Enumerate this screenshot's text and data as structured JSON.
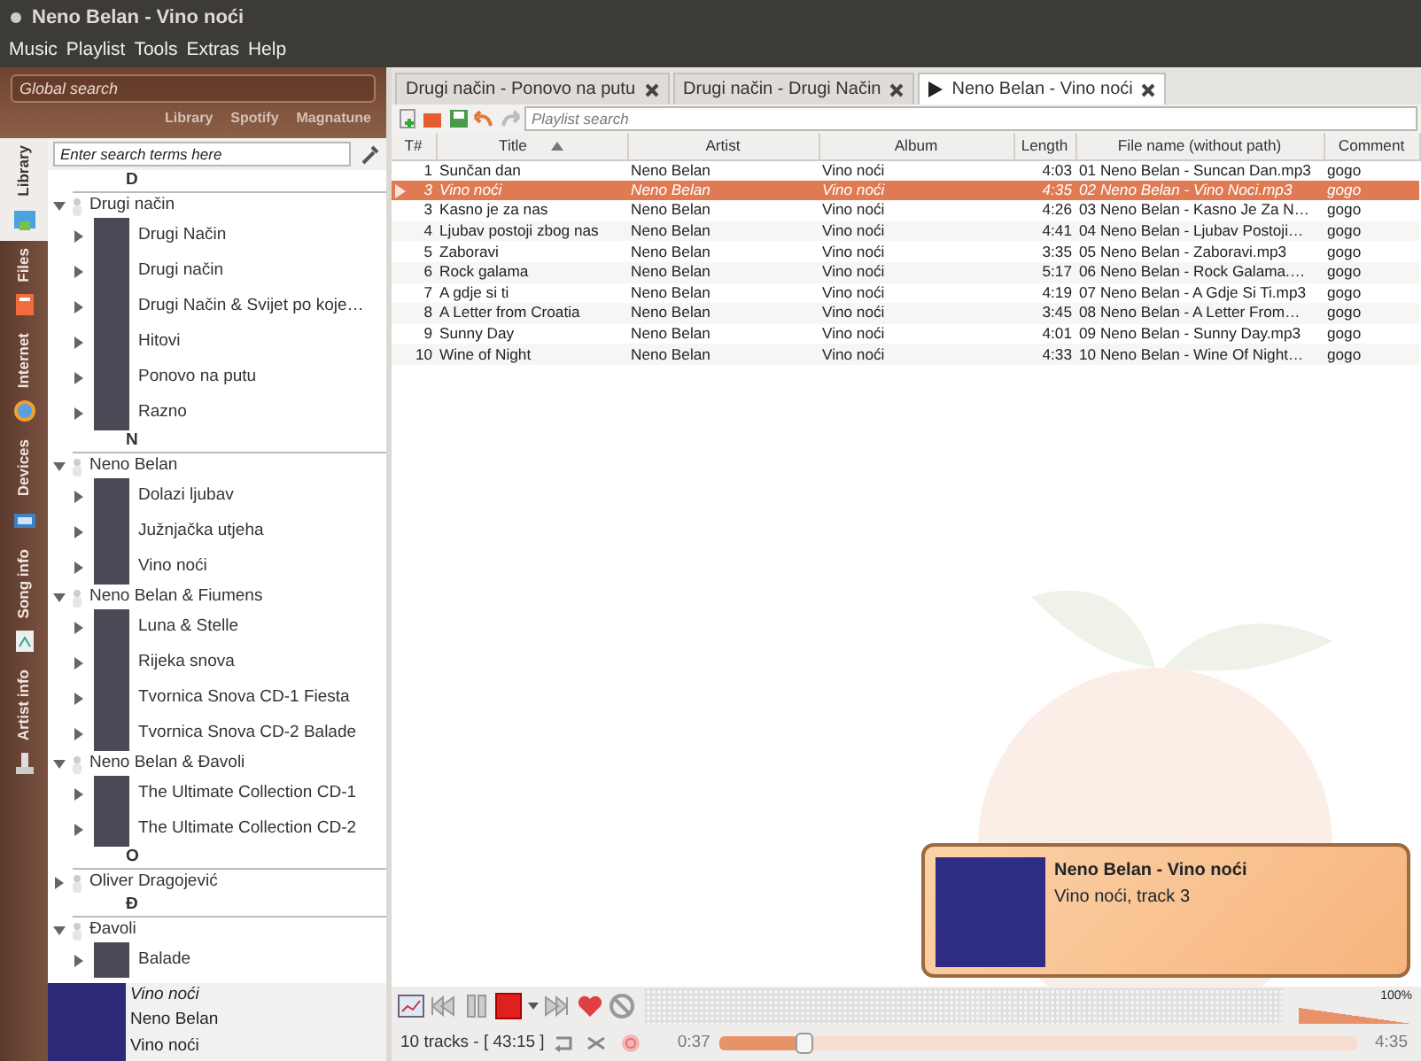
{
  "window": {
    "title": "Neno Belan - Vino noći"
  },
  "menu": [
    "Music",
    "Playlist",
    "Tools",
    "Extras",
    "Help"
  ],
  "global_search": {
    "placeholder": "Global search",
    "sources": [
      "Library",
      "Spotify",
      "Magnatune"
    ]
  },
  "side_tabs": [
    {
      "label": "Library",
      "selected": true
    },
    {
      "label": "Files",
      "selected": false
    },
    {
      "label": "Internet",
      "selected": false
    },
    {
      "label": "Devices",
      "selected": false
    },
    {
      "label": "Song info",
      "selected": false
    },
    {
      "label": "Artist info",
      "selected": false
    }
  ],
  "library": {
    "search_placeholder": "Enter search terms here",
    "tree": [
      {
        "kind": "divider",
        "label": "D"
      },
      {
        "kind": "artist",
        "label": "Drugi način",
        "expanded": true,
        "children": [
          {
            "label": "Drugi Način",
            "expanded": false
          },
          {
            "label": "Drugi način",
            "expanded": false
          },
          {
            "label": "Drugi Način & Svijet po koje…",
            "expanded": false
          },
          {
            "label": "Hitovi",
            "expanded": false
          },
          {
            "label": "Ponovo na putu",
            "expanded": false
          },
          {
            "label": "Razno",
            "expanded": false
          }
        ]
      },
      {
        "kind": "divider",
        "label": "N"
      },
      {
        "kind": "artist",
        "label": "Neno Belan",
        "expanded": true,
        "children": [
          {
            "label": "Dolazi ljubav",
            "expanded": false
          },
          {
            "label": "Južnjačka utjeha",
            "expanded": false
          },
          {
            "label": "Vino noći",
            "expanded": false
          }
        ]
      },
      {
        "kind": "artist",
        "label": "Neno Belan & Fiumens",
        "expanded": true,
        "children": [
          {
            "label": "Luna & Stelle",
            "expanded": false
          },
          {
            "label": "Rijeka snova",
            "expanded": false
          },
          {
            "label": "Tvornica Snova CD-1 Fiesta",
            "expanded": false
          },
          {
            "label": "Tvornica Snova CD-2 Balade",
            "expanded": false
          }
        ]
      },
      {
        "kind": "artist",
        "label": "Neno Belan & Đavoli",
        "expanded": true,
        "children": [
          {
            "label": "The Ultimate Collection CD-1",
            "expanded": false
          },
          {
            "label": "The Ultimate Collection CD-2",
            "expanded": false
          }
        ]
      },
      {
        "kind": "divider",
        "label": "O"
      },
      {
        "kind": "artist",
        "label": "Oliver Dragojević",
        "expanded": false
      },
      {
        "kind": "divider",
        "label": "Đ"
      },
      {
        "kind": "artist",
        "label": "Đavoli",
        "expanded": true,
        "children": [
          {
            "label": "Balade",
            "expanded": false
          }
        ]
      }
    ]
  },
  "now_playing": {
    "title": "Vino noći",
    "artist": "Neno Belan",
    "album": "Vino noći"
  },
  "playlist_tabs": [
    {
      "label": "Drugi način - Ponovo na putu",
      "selected": false,
      "playing": false
    },
    {
      "label": "Drugi način - Drugi Način",
      "selected": false,
      "playing": false
    },
    {
      "label": "Neno Belan - Vino noći",
      "selected": true,
      "playing": true
    }
  ],
  "playlist": {
    "search_placeholder": "Playlist search",
    "columns": [
      {
        "label": "T#",
        "sorted": false
      },
      {
        "label": "Title",
        "sorted": true
      },
      {
        "label": "Artist",
        "sorted": false
      },
      {
        "label": "Album",
        "sorted": false
      },
      {
        "label": "Length",
        "sorted": false
      },
      {
        "label": "File name (without path)",
        "sorted": false
      },
      {
        "label": "Comment",
        "sorted": false
      }
    ],
    "rows": [
      {
        "playing": false,
        "cells": [
          "1",
          "Sunčan dan",
          "Neno Belan",
          "Vino noći",
          "4:03",
          "01 Neno Belan - Suncan Dan.mp3",
          "gogo"
        ]
      },
      {
        "playing": true,
        "cells": [
          "3",
          "Vino noći",
          "Neno Belan",
          "Vino noći",
          "4:35",
          "02 Neno Belan - Vino Noci.mp3",
          "gogo"
        ]
      },
      {
        "playing": false,
        "cells": [
          "3",
          "Kasno je za nas",
          "Neno Belan",
          "Vino noći",
          "4:26",
          "03 Neno Belan - Kasno Je Za N…",
          "gogo"
        ]
      },
      {
        "playing": false,
        "cells": [
          "4",
          "Ljubav postoji zbog nas",
          "Neno Belan",
          "Vino noći",
          "4:41",
          "04 Neno Belan - Ljubav Postoji…",
          "gogo"
        ]
      },
      {
        "playing": false,
        "cells": [
          "5",
          "Zaboravi",
          "Neno Belan",
          "Vino noći",
          "3:35",
          "05 Neno Belan - Zaboravi.mp3",
          "gogo"
        ]
      },
      {
        "playing": false,
        "cells": [
          "6",
          "Rock galama",
          "Neno Belan",
          "Vino noći",
          "5:17",
          "06 Neno Belan - Rock Galama.…",
          "gogo"
        ]
      },
      {
        "playing": false,
        "cells": [
          "7",
          "A gdje si ti",
          "Neno Belan",
          "Vino noći",
          "4:19",
          "07 Neno Belan - A Gdje Si Ti.mp3",
          "gogo"
        ]
      },
      {
        "playing": false,
        "cells": [
          "8",
          "A Letter from Croatia",
          "Neno Belan",
          "Vino noći",
          "3:45",
          "08 Neno Belan - A Letter From…",
          "gogo"
        ]
      },
      {
        "playing": false,
        "cells": [
          "9",
          "Sunny Day",
          "Neno Belan",
          "Vino noći",
          "4:01",
          "09 Neno Belan - Sunny Day.mp3",
          "gogo"
        ]
      },
      {
        "playing": false,
        "cells": [
          "10",
          "Wine of Night",
          "Neno Belan",
          "Vino noći",
          "4:33",
          "10 Neno Belan - Wine Of Night…",
          "gogo"
        ]
      }
    ]
  },
  "notification": {
    "title": "Neno Belan - Vino noći",
    "text": "Vino noći, track 3"
  },
  "player": {
    "volume_label": "100%",
    "volume": {
      "level": 1.0
    },
    "status": "10 tracks - [ 43:15 ]",
    "elapsed": "0:37",
    "total": "4:35",
    "seek": {
      "level": 0.135
    }
  }
}
